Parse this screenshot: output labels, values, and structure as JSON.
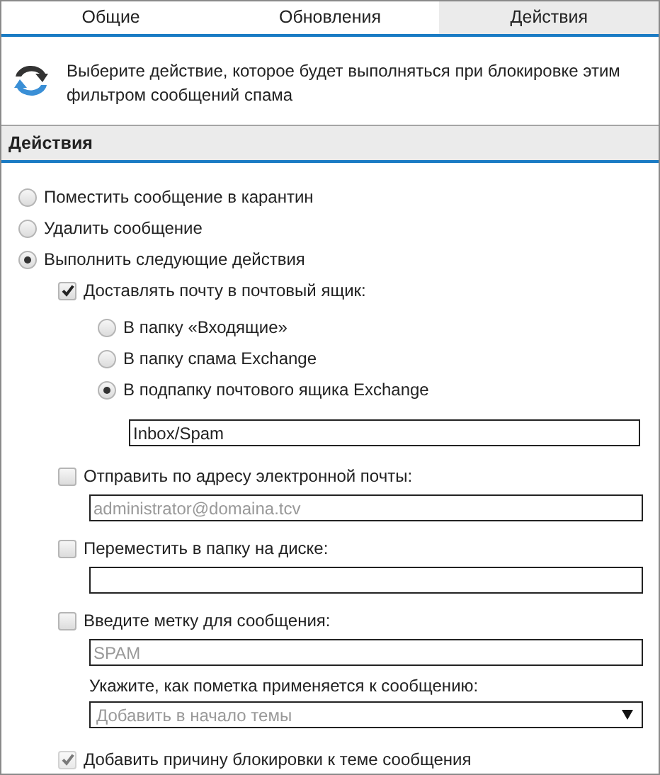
{
  "tabs": [
    {
      "label": "Общие",
      "selected": false
    },
    {
      "label": "Обновления",
      "selected": false
    },
    {
      "label": "Действия",
      "selected": true
    }
  ],
  "description": "Выберите действие, которое будет выполняться при блокировке этим фильтром сообщений спама",
  "section_title": "Действия",
  "options": [
    {
      "label": "Поместить сообщение в карантин",
      "selected": false
    },
    {
      "label": "Удалить сообщение",
      "selected": false
    },
    {
      "label": "Выполнить следующие действия",
      "selected": true
    }
  ],
  "actions": [
    {
      "kind": "mailbox",
      "label": "Доставлять почту в почтовый ящик:",
      "checked": true,
      "disabled": false,
      "targets": [
        {
          "label": "В папку «Входящие»",
          "selected": false
        },
        {
          "label": "В папку спама Exchange",
          "selected": false
        },
        {
          "label": "В подпапку почтового ящика Exchange",
          "selected": true
        }
      ],
      "field": {
        "value": "Inbox/Spam",
        "disabled": false
      }
    },
    {
      "kind": "field",
      "label": "Отправить по адресу электронной почты:",
      "checked": false,
      "disabled": false,
      "field": {
        "value": "administrator@domaina.tcv",
        "disabled": true
      }
    },
    {
      "kind": "field",
      "label": "Переместить в папку на диске:",
      "checked": false,
      "disabled": false
    },
    {
      "kind": "tag",
      "label": "Введите метку для сообщения:",
      "checked": false,
      "disabled": false,
      "field": {
        "value": "SPAM",
        "disabled": true
      },
      "note": "Укажите, как пометка применяется к сообщению:",
      "select": {
        "value": "Добавить в начало темы",
        "disabled": true
      }
    },
    {
      "kind": "plain",
      "label": "Добавить причину блокировки к теме сообщения",
      "checked": true,
      "disabled": true
    }
  ]
}
